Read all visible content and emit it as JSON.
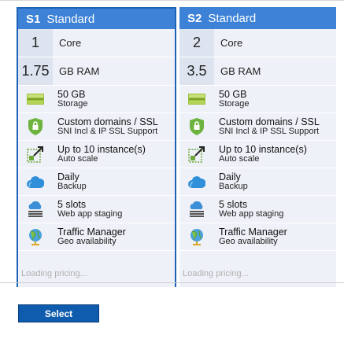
{
  "tiers": [
    {
      "code": "S1",
      "name": "Standard",
      "cores": "1",
      "cores_label": "Core",
      "ram": "1.75",
      "ram_label": "GB RAM",
      "features": [
        {
          "icon": "storage-icon",
          "title": "50 GB",
          "sub": "Storage"
        },
        {
          "icon": "ssl-shield-icon",
          "title": "Custom domains / SSL",
          "sub": "SNI Incl & IP SSL Support"
        },
        {
          "icon": "autoscale-icon",
          "title": "Up to 10 instance(s)",
          "sub": "Auto scale"
        },
        {
          "icon": "cloud-backup-icon",
          "title": "Daily",
          "sub": "Backup"
        },
        {
          "icon": "staging-slots-icon",
          "title": "5 slots",
          "sub": "Web app staging"
        },
        {
          "icon": "globe-icon",
          "title": "Traffic Manager",
          "sub": "Geo availability"
        }
      ],
      "loading": "Loading pricing..."
    },
    {
      "code": "S2",
      "name": "Standard",
      "cores": "2",
      "cores_label": "Core",
      "ram": "3.5",
      "ram_label": "GB RAM",
      "features": [
        {
          "icon": "storage-icon",
          "title": "50 GB",
          "sub": "Storage"
        },
        {
          "icon": "ssl-shield-icon",
          "title": "Custom domains / SSL",
          "sub": "SNI Incl & IP SSL Support"
        },
        {
          "icon": "autoscale-icon",
          "title": "Up to 10 instance(s)",
          "sub": "Auto scale"
        },
        {
          "icon": "cloud-backup-icon",
          "title": "Daily",
          "sub": "Backup"
        },
        {
          "icon": "staging-slots-icon",
          "title": "5 slots",
          "sub": "Web app staging"
        },
        {
          "icon": "globe-icon",
          "title": "Traffic Manager",
          "sub": "Geo availability"
        }
      ],
      "loading": "Loading pricing..."
    }
  ],
  "footer": {
    "select_label": "Select"
  },
  "colors": {
    "header": "#3d82d6",
    "selected_border": "#1c63b7",
    "card_bg": "#eef1f7",
    "button": "#0f5cae"
  }
}
